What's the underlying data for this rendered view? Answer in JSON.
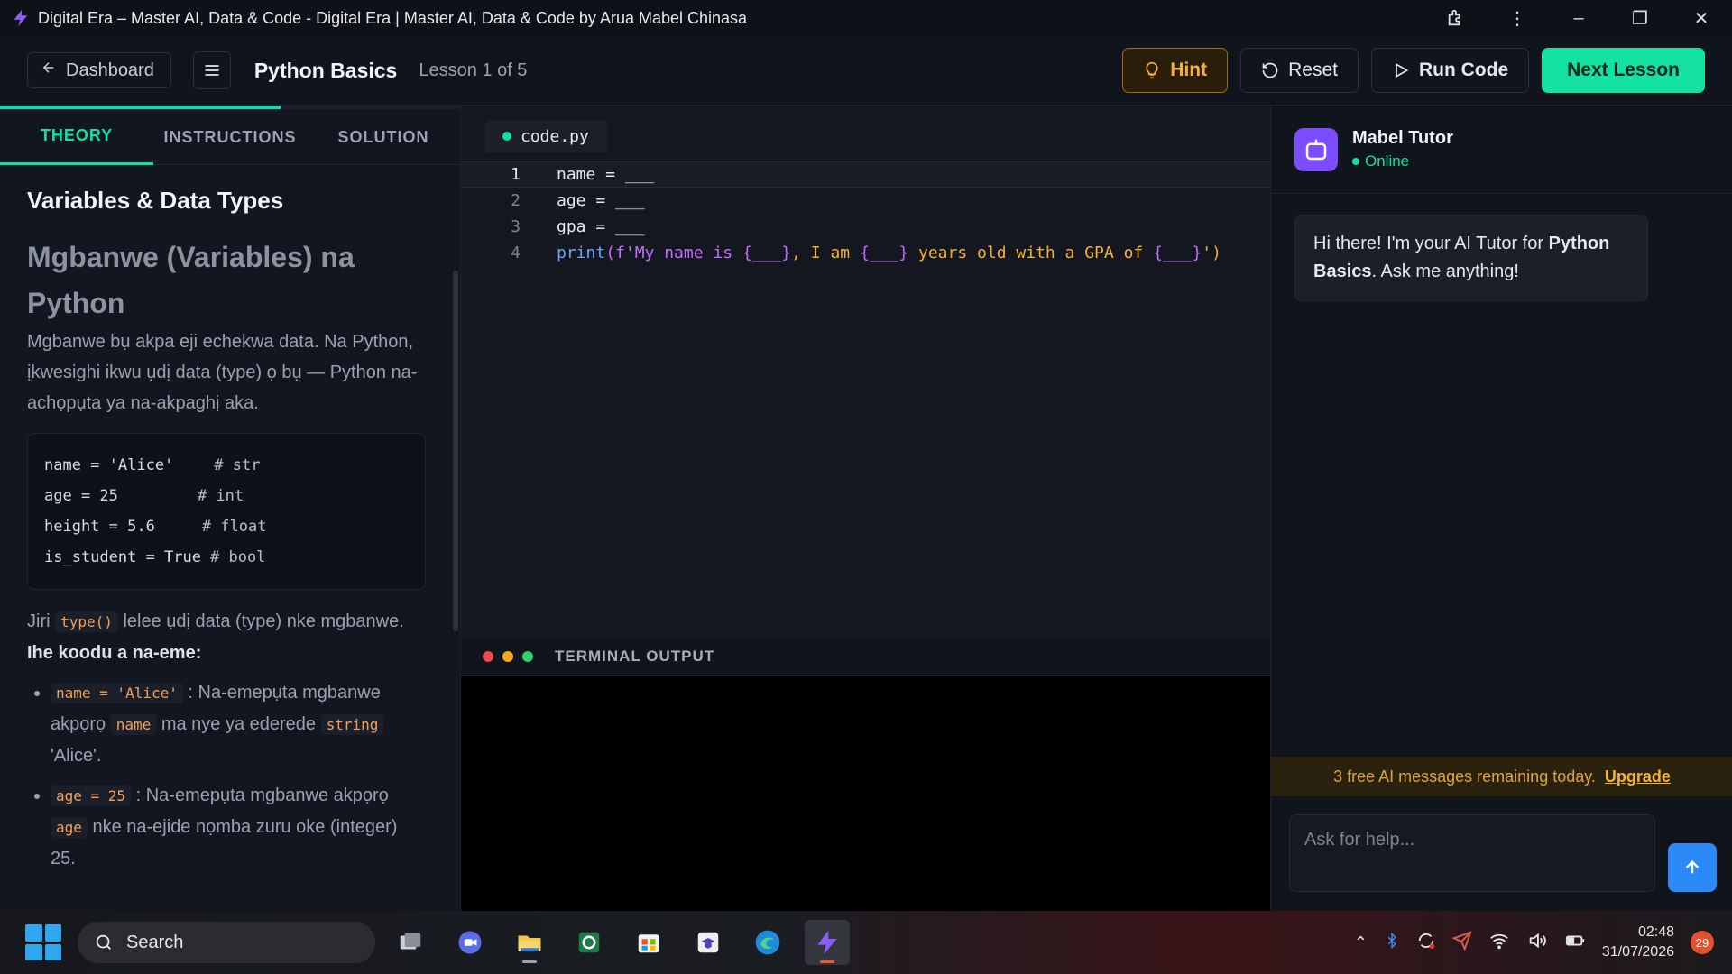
{
  "window": {
    "title": "Digital Era – Master AI, Data & Code - Digital Era | Master AI, Data & Code by Arua Mabel Chinasa"
  },
  "header": {
    "dashboard_label": "Dashboard",
    "course_title": "Python Basics",
    "lesson_count": "Lesson 1 of 5",
    "hint_label": "Hint",
    "reset_label": "Reset",
    "run_label": "Run Code",
    "next_label": "Next Lesson"
  },
  "lesson_progress": 0.61,
  "tabs": [
    {
      "label": "THEORY",
      "active": true
    },
    {
      "label": "INSTRUCTIONS",
      "active": false
    },
    {
      "label": "SOLUTION",
      "active": false
    }
  ],
  "theory": {
    "section_title": "Variables & Data Types",
    "heading": "Mgbanwe (Variables) na Python",
    "intro": "Mgbanwe bụ akpa eji echekwa data. Na Python, ịkwesighi ikwu ụdị data (type) ọ bụ — Python na-achọpụta ya na-akpaghị aka.",
    "example_code": [
      {
        "code": "name = 'Alice'",
        "comment": "# str"
      },
      {
        "code": "age = 25",
        "comment": "# int"
      },
      {
        "code": "height = 5.6",
        "comment": "# float"
      },
      {
        "code": "is_student = True",
        "comment": "# bool"
      }
    ],
    "type_text_pre": "Jiri",
    "type_fn": "type()",
    "type_text_post": "lelee ụdị data (type) nke mgbanwe.",
    "what_code_does": "Ihe koodu a na-eme:",
    "bullets": [
      {
        "code": "name = 'Alice'",
        "text1": ": Na-emepụta mgbanwe akpọrọ",
        "code2": "name",
        "text2": "ma nye ya ederede",
        "code3": "string",
        "text3": "'Alice'."
      },
      {
        "code": "age = 25",
        "text1": ": Na-emepụta mgbanwe akpọrọ",
        "code2": "age",
        "text2": "nke na-ejide nọmba zuru oke (integer) 25."
      }
    ]
  },
  "editor": {
    "file_name": "code.py",
    "lines": [
      {
        "num": "1",
        "text": "name = ___"
      },
      {
        "num": "2",
        "text": "age = ___"
      },
      {
        "num": "3",
        "text": "gpa = ___"
      },
      {
        "num": "4",
        "print": "print",
        "open": "(",
        "fprefix": "f",
        "s1": "'My name is ",
        "b1": "{___}",
        "s2": ", I am ",
        "b2": "{___}",
        "s3": " years old with a GPA of ",
        "b3": "{___}",
        "s4": "'",
        "close": ")"
      }
    ]
  },
  "terminal": {
    "title": "TERMINAL OUTPUT"
  },
  "tutor": {
    "name": "Mabel Tutor",
    "status": "Online",
    "greeting_pre": "Hi there! I'm your AI Tutor for ",
    "greeting_bold": "Python Basics",
    "greeting_post": ". Ask me anything!",
    "quota_text": "3 free AI messages remaining today.",
    "upgrade_label": "Upgrade",
    "input_placeholder": "Ask for help..."
  },
  "taskbar": {
    "search_label": "Search",
    "time": "02:48",
    "date": "31/07/2026",
    "notifications": "29"
  },
  "colors": {
    "accent_green": "#14e0a0",
    "hint_amber": "#f5b132",
    "tutor_purple": "#7c4dff",
    "send_blue": "#2b8af7"
  }
}
